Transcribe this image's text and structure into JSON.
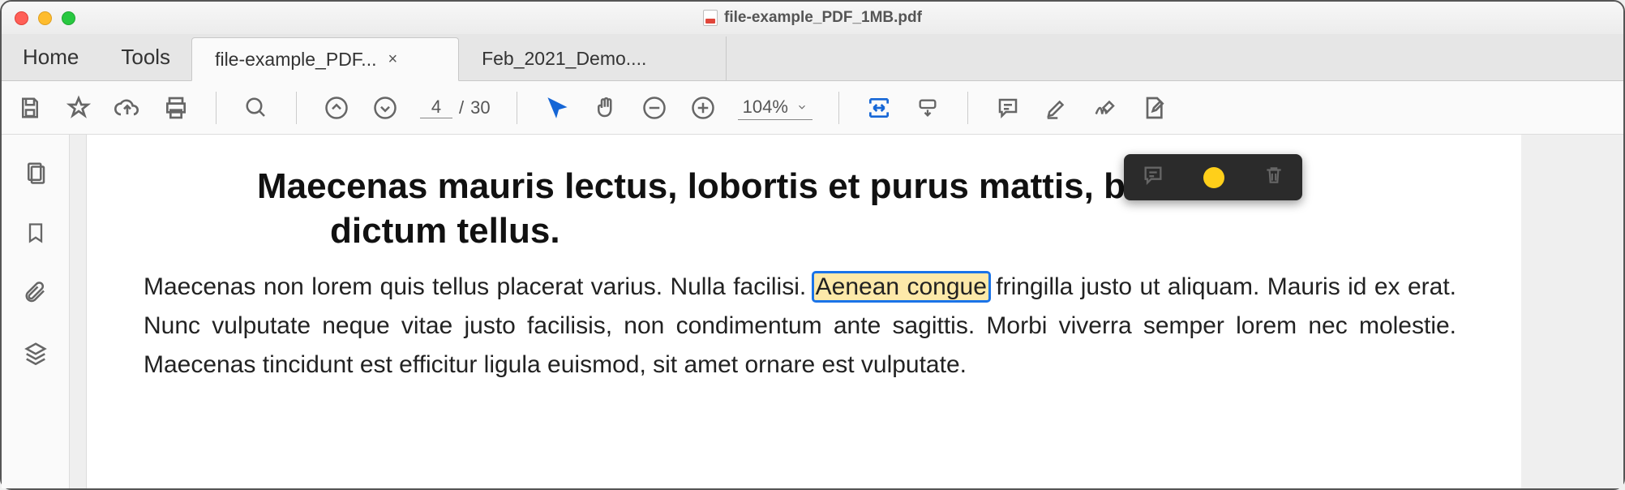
{
  "window": {
    "title": "file-example_PDF_1MB.pdf"
  },
  "menu": {
    "home": "Home",
    "tools": "Tools"
  },
  "tabs": [
    {
      "label": "file-example_PDF...",
      "active": true
    },
    {
      "label": "Feb_2021_Demo....",
      "active": false
    }
  ],
  "toolbar": {
    "page_current": "4",
    "page_sep": "/",
    "page_total": "30",
    "zoom": "104%"
  },
  "document": {
    "heading_line1": "Maecenas mauris lectus, lobortis et purus mattis, blandit",
    "heading_line2": "dictum tellus.",
    "para_before": "Maecenas non lorem quis tellus placerat varius. Nulla facilisi. ",
    "highlight": "Aenean congue",
    "para_after": " fringilla justo ut aliquam. Mauris id ex erat. Nunc vulputate neque vitae justo facilisis, non condimentum ante sagittis. Morbi viverra semper lorem nec molestie. Maecenas tincidunt est efficitur ligula euismod, sit amet ornare est vulputate."
  }
}
